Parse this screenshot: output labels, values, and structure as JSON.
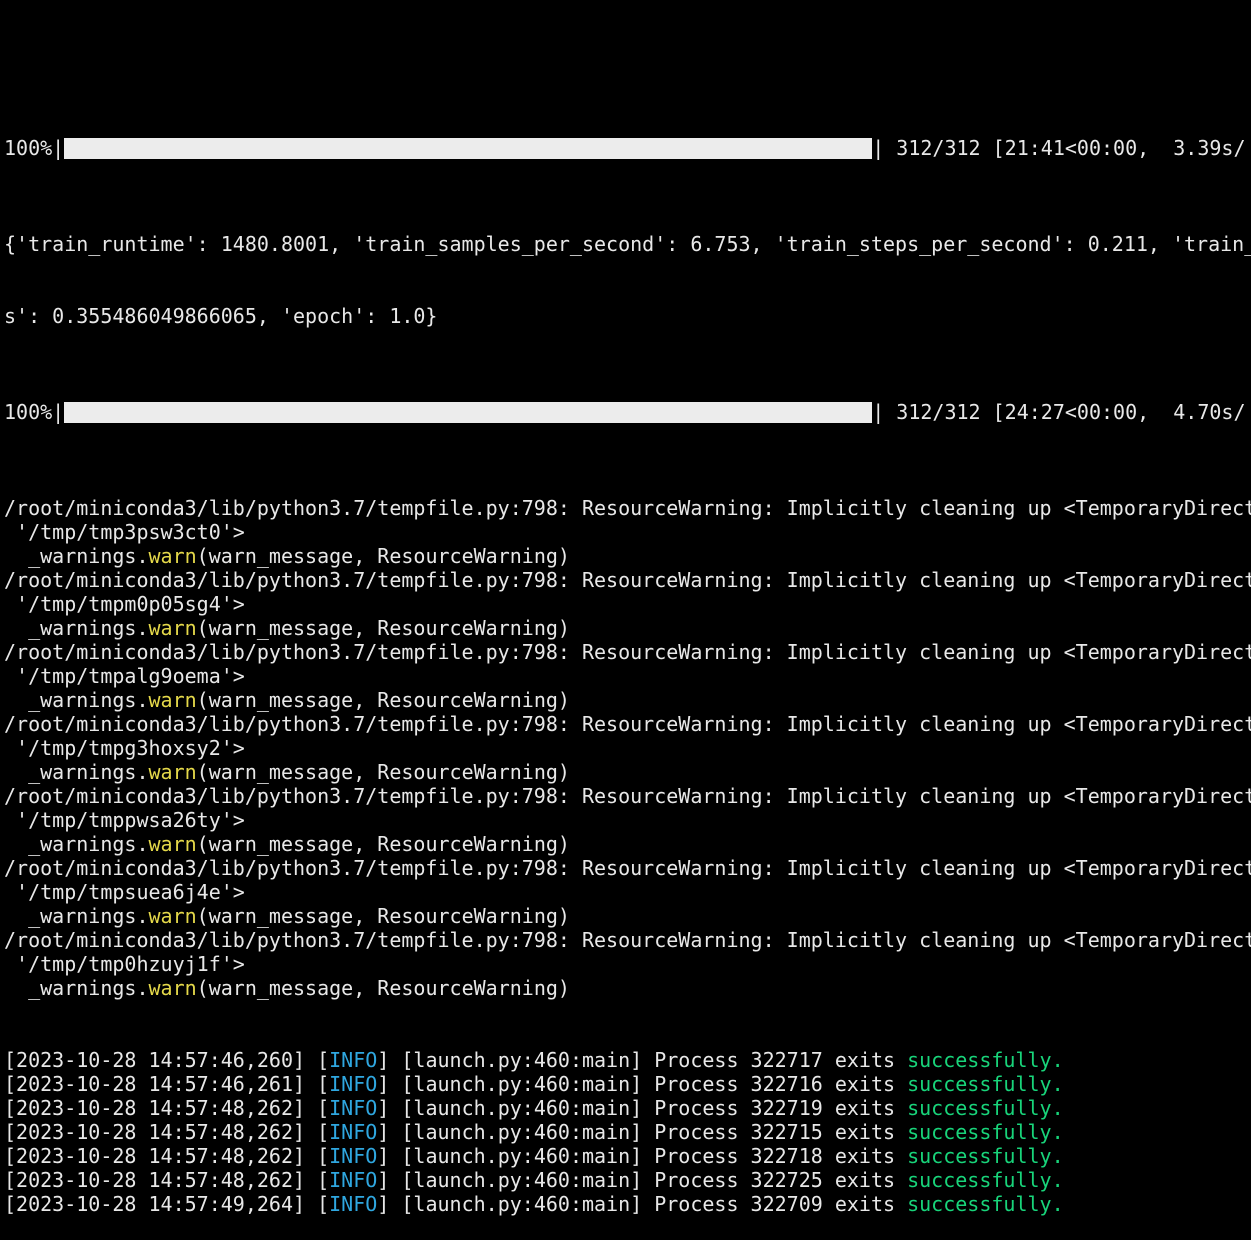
{
  "terminal": {
    "top_partial": "",
    "progress1": {
      "percent": "100%",
      "left_sep": "|",
      "right": "| 312/312 [21:41<00:00,  3.39s/",
      "fraction": 1.0
    },
    "summary": {
      "line1": "{'train_runtime': 1480.8001, 'train_samples_per_second': 6.753, 'train_steps_per_second': 0.211, 'train_",
      "line2": "s': 0.355486049866065, 'epoch': 1.0}"
    },
    "progress2": {
      "percent": "100%",
      "left_sep": "|",
      "right": "| 312/312 [24:27<00:00,  4.70s/",
      "fraction": 1.0
    },
    "warnings": [
      {
        "path": "/root/miniconda3/lib/python3.7/tempfile.py:798: ResourceWarning: Implicitly cleaning up <TemporaryDirect",
        "dir": " '/tmp/tmp3psw3ct0'>",
        "pre": "  _warnings.",
        "fn": "warn",
        "post": "(warn_message, ResourceWarning)"
      },
      {
        "path": "/root/miniconda3/lib/python3.7/tempfile.py:798: ResourceWarning: Implicitly cleaning up <TemporaryDirect",
        "dir": " '/tmp/tmpm0p05sg4'>",
        "pre": "  _warnings.",
        "fn": "warn",
        "post": "(warn_message, ResourceWarning)"
      },
      {
        "path": "/root/miniconda3/lib/python3.7/tempfile.py:798: ResourceWarning: Implicitly cleaning up <TemporaryDirect",
        "dir": " '/tmp/tmpalg9oema'>",
        "pre": "  _warnings.",
        "fn": "warn",
        "post": "(warn_message, ResourceWarning)"
      },
      {
        "path": "/root/miniconda3/lib/python3.7/tempfile.py:798: ResourceWarning: Implicitly cleaning up <TemporaryDirect",
        "dir": " '/tmp/tmpg3hoxsy2'>",
        "pre": "  _warnings.",
        "fn": "warn",
        "post": "(warn_message, ResourceWarning)"
      },
      {
        "path": "/root/miniconda3/lib/python3.7/tempfile.py:798: ResourceWarning: Implicitly cleaning up <TemporaryDirect",
        "dir": " '/tmp/tmppwsa26ty'>",
        "pre": "  _warnings.",
        "fn": "warn",
        "post": "(warn_message, ResourceWarning)"
      },
      {
        "path": "/root/miniconda3/lib/python3.7/tempfile.py:798: ResourceWarning: Implicitly cleaning up <TemporaryDirect",
        "dir": " '/tmp/tmpsuea6j4e'>",
        "pre": "  _warnings.",
        "fn": "warn",
        "post": "(warn_message, ResourceWarning)"
      },
      {
        "path": "/root/miniconda3/lib/python3.7/tempfile.py:798: ResourceWarning: Implicitly cleaning up <TemporaryDirect",
        "dir": " '/tmp/tmp0hzuyj1f'>",
        "pre": "  _warnings.",
        "fn": "warn",
        "post": "(warn_message, ResourceWarning)"
      }
    ],
    "logs": [
      {
        "time": "[2023-10-28 14:57:46,260] [",
        "level": "INFO",
        "mid": "] [launch.py:460:main] Process 322717 exits ",
        "status": "successfully."
      },
      {
        "time": "[2023-10-28 14:57:46,261] [",
        "level": "INFO",
        "mid": "] [launch.py:460:main] Process 322716 exits ",
        "status": "successfully."
      },
      {
        "time": "[2023-10-28 14:57:48,262] [",
        "level": "INFO",
        "mid": "] [launch.py:460:main] Process 322719 exits ",
        "status": "successfully."
      },
      {
        "time": "[2023-10-28 14:57:48,262] [",
        "level": "INFO",
        "mid": "] [launch.py:460:main] Process 322715 exits ",
        "status": "successfully."
      },
      {
        "time": "[2023-10-28 14:57:48,262] [",
        "level": "INFO",
        "mid": "] [launch.py:460:main] Process 322718 exits ",
        "status": "successfully."
      },
      {
        "time": "[2023-10-28 14:57:48,262] [",
        "level": "INFO",
        "mid": "] [launch.py:460:main] Process 322725 exits ",
        "status": "successfully."
      },
      {
        "time": "[2023-10-28 14:57:49,264] [",
        "level": "INFO",
        "mid": "] [launch.py:460:main] Process 322709 exits ",
        "status": "successfully."
      }
    ],
    "colors": {
      "background": "#000000",
      "text": "#e8e8e8",
      "warn_fn": "#e5d94a",
      "info": "#2fa7e0",
      "success": "#18d47a",
      "progress_bar": "#ececec"
    }
  }
}
